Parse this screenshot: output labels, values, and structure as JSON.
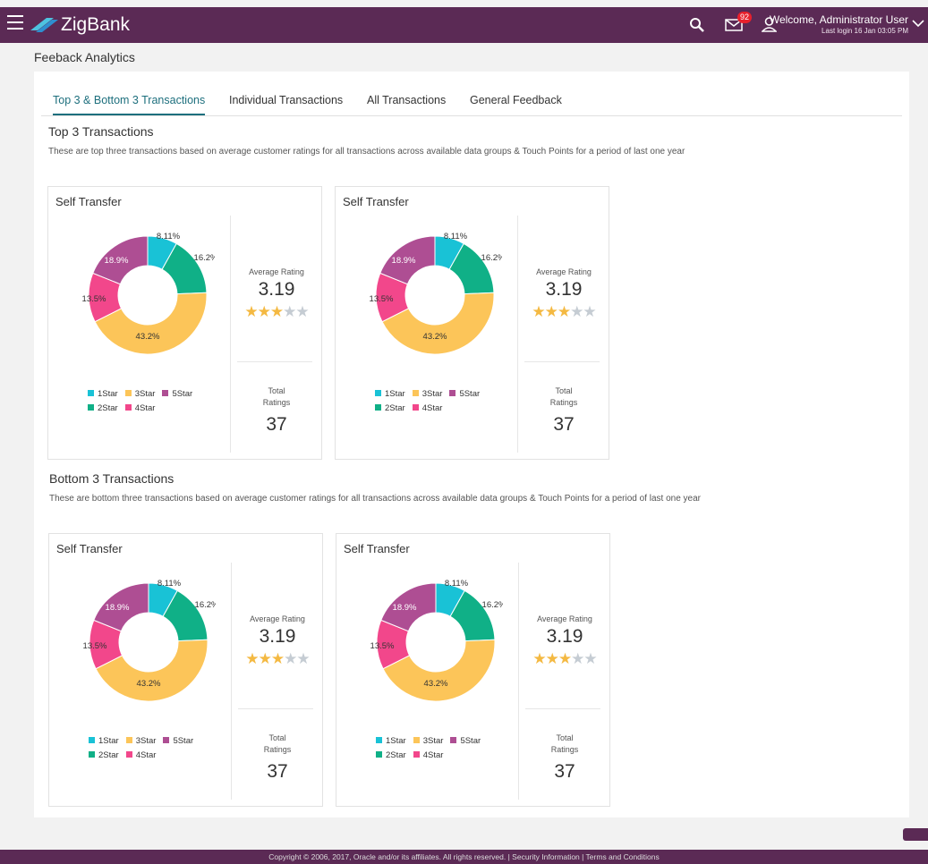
{
  "header": {
    "brand": "ZigBank",
    "notification_count": "92",
    "welcome": "Welcome, Administrator User",
    "last_login": "Last login 16 Jan 03:05 PM"
  },
  "page_title": "Feeback Analytics",
  "tabs": [
    {
      "label": "Top 3 & Bottom 3 Transactions",
      "active": true
    },
    {
      "label": "Individual Transactions",
      "active": false
    },
    {
      "label": "All Transactions",
      "active": false
    },
    {
      "label": "General Feedback",
      "active": false
    }
  ],
  "sections": [
    {
      "title": "Top 3 Transactions",
      "description": "These are top three transactions based on average customer ratings for all transactions across available data groups & Touch Points for a period of last one year"
    },
    {
      "title": "Bottom 3 Transactions",
      "description": "These are bottom three transactions based on average customer ratings for all transactions across available data groups & Touch Points for a period of last one year"
    }
  ],
  "card_labels": {
    "average_rating": "Average Rating",
    "total": "Total",
    "ratings": "Ratings"
  },
  "cards": [
    {
      "title": "Self Transfer",
      "average_rating": "3.19",
      "total_ratings": "37",
      "stars_filled": 3,
      "stars_max": 5
    },
    {
      "title": "Self Transfer",
      "average_rating": "3.19",
      "total_ratings": "37",
      "stars_filled": 3,
      "stars_max": 5
    },
    {
      "title": "Self Transfer",
      "average_rating": "3.19",
      "total_ratings": "37",
      "stars_filled": 3,
      "stars_max": 5
    },
    {
      "title": "Self Transfer",
      "average_rating": "3.19",
      "total_ratings": "37",
      "stars_filled": 3,
      "stars_max": 5
    }
  ],
  "chart_data": {
    "type": "pie",
    "categories": [
      "1Star",
      "2Star",
      "3Star",
      "4Star",
      "5Star"
    ],
    "values": [
      8.11,
      16.2,
      43.2,
      13.5,
      18.9
    ],
    "labels": [
      "8.11%",
      "16.2%",
      "43.2%",
      "13.5%",
      "18.9%"
    ],
    "colors": [
      "#19c2d6",
      "#10b087",
      "#fcc559",
      "#f2478b",
      "#ae4e93"
    ]
  },
  "legend_rows": [
    [
      {
        "label": "1Star",
        "color": "#19c2d6"
      },
      {
        "label": "3Star",
        "color": "#fcc559"
      },
      {
        "label": "5Star",
        "color": "#ae4e93"
      }
    ],
    [
      {
        "label": "2Star",
        "color": "#10b087"
      },
      {
        "label": "4Star",
        "color": "#f2478b"
      }
    ]
  ],
  "footer": "Copyright © 2006, 2017, Oracle and/or its affiliates. All rights reserved. | Security Information | Terms and Conditions",
  "colors": {
    "brand": "#5b2a55",
    "accent": "#1d6f7d"
  }
}
